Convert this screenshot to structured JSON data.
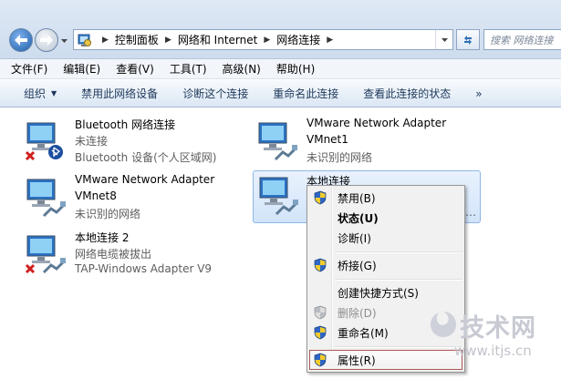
{
  "address": {
    "crumbs": [
      "控制面板",
      "网络和 Internet",
      "网络连接"
    ],
    "search_placeholder": "搜索 网络连接"
  },
  "menu": [
    "文件(F)",
    "编辑(E)",
    "查看(V)",
    "工具(T)",
    "高级(N)",
    "帮助(H)"
  ],
  "toolbar": {
    "organize": "组织",
    "items": [
      "禁用此网络设备",
      "诊断这个连接",
      "重命名此连接",
      "查看此连接的状态"
    ],
    "more": "»"
  },
  "connections": [
    {
      "name": "Bluetooth 网络连接",
      "line2": "未连接",
      "line3": "Bluetooth 设备(个人区域网)"
    },
    {
      "name": "VMware Network Adapter",
      "line2": "VMnet1",
      "line3": "未识别的网络"
    },
    {
      "name": "VMware Network Adapter",
      "line2": "VMnet8",
      "line3": "未识别的网络"
    },
    {
      "name": "本地连接",
      "line2": "",
      "line3": "…"
    },
    {
      "name": "本地连接 2",
      "line2": "网络电缆被拔出",
      "line3": "TAP-Windows Adapter V9"
    }
  ],
  "context_menu": {
    "disable": "禁用(B)",
    "status": "状态(U)",
    "diagnose": "诊断(I)",
    "bridge": "桥接(G)",
    "shortcut": "创建快捷方式(S)",
    "delete": "删除(D)",
    "rename": "重命名(M)",
    "properties": "属性(R)"
  },
  "watermark": {
    "brand": "技术网",
    "url": "www.itjs.cn"
  },
  "colors": {
    "accent": "#1f5ea9",
    "highlight_border": "#ae5858",
    "selected_bg": "#d2e4fa"
  }
}
